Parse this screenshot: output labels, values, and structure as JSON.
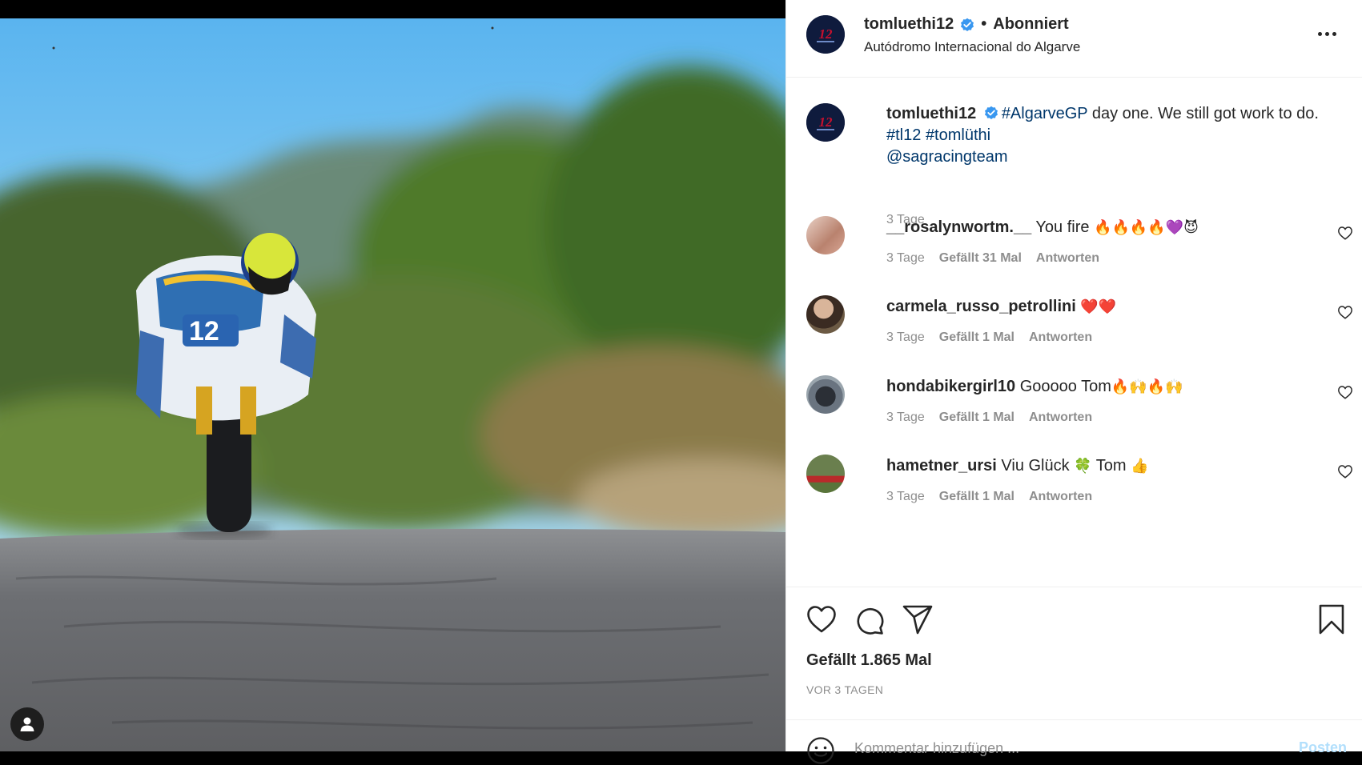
{
  "post": {
    "username": "tomluethi12",
    "separator": "•",
    "follow_state": "Abonniert",
    "location": "Autódromo Internacional do Algarve",
    "caption_text": " day one. We still got work to do.",
    "caption_hashtag_1": "#AlgarveGP",
    "caption_hashtag_2": "#tl12",
    "caption_hashtag_3": "#tomlüthi",
    "caption_mention": "@sagracingteam",
    "caption_time": "3 Tage",
    "likes": "Gefällt 1.865 Mal",
    "timestamp": "VOR 3 TAGEN"
  },
  "comments": [
    {
      "username": "__rosalynwortm.__",
      "text": " You fire ",
      "emoji": "🔥🔥🔥🔥💜😈",
      "time": "3 Tage",
      "likes": "Gefällt 31 Mal",
      "reply": "Antworten"
    },
    {
      "username": "carmela_russo_petrollini",
      "text": " ",
      "emoji": "❤️❤️",
      "time": "3 Tage",
      "likes": "Gefällt 1 Mal",
      "reply": "Antworten"
    },
    {
      "username": "hondabikergirl10",
      "text": " Gooooo Tom",
      "emoji": "🔥🙌🔥🙌",
      "time": "3 Tage",
      "likes": "Gefällt 1 Mal",
      "reply": "Antworten"
    },
    {
      "username": "hametner_ursi",
      "text": " Viu Glück ",
      "emoji": "🍀",
      "text2": " Tom ",
      "emoji2": "👍",
      "time": "3 Tage",
      "likes": "Gefällt 1 Mal",
      "reply": "Antworten"
    }
  ],
  "add_comment": {
    "placeholder": "Kommentar hinzufügen ...",
    "post_label": "Posten"
  },
  "icons": {
    "like": "heart-icon",
    "comment": "comment-icon",
    "share": "paper-plane-icon",
    "save": "bookmark-icon",
    "more": "more-dots-icon",
    "verified": "verified-badge-icon",
    "emoji": "emoji-icon",
    "user": "user-icon"
  },
  "colors": {
    "link": "#00376b",
    "verified": "#3897f0",
    "muted": "#8e8e8e",
    "text": "#262626",
    "post_button_disabled": "#b2dffc"
  }
}
